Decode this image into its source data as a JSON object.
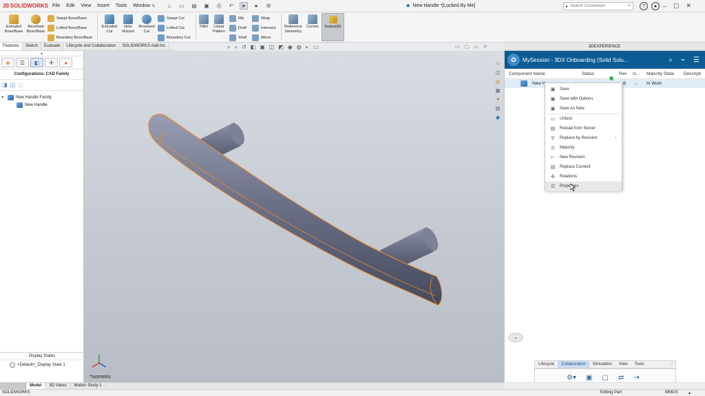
{
  "titlebar": {
    "brand": "SOLIDWORKS",
    "menu": [
      "File",
      "Edit",
      "View",
      "Insert",
      "Tools",
      "Window"
    ],
    "document_title": "New Handle *[Locked By Me]",
    "search_placeholder": "Search Commands"
  },
  "ribbon": {
    "extruded_boss": "Extruded Boss/Base",
    "revolved_boss": "Revolved Boss/Base",
    "swept_boss": "Swept Boss/Base",
    "lofted_boss": "Lofted Boss/Base",
    "boundary_boss": "Boundary Boss/Base",
    "extruded_cut": "Extruded Cut",
    "hole_wizard": "Hole Wizard",
    "revolved_cut": "Revolved Cut",
    "swept_cut": "Swept Cut",
    "lofted_cut": "Lofted Cut",
    "boundary_cut": "Boundary Cut",
    "fillet": "Fillet",
    "linear_pattern": "Linear Pattern",
    "rib": "Rib",
    "draft": "Draft",
    "shell": "Shell",
    "wrap": "Wrap",
    "intersect": "Intersect",
    "mirror": "Mirror",
    "reference_geometry": "Reference Geometry",
    "curves": "Curves",
    "instant3d": "Instant3D"
  },
  "command_tabs": [
    "Features",
    "Sketch",
    "Evaluate",
    "Lifecycle and Collaboration",
    "SOLIDWORKS Add-Ins"
  ],
  "left_panel": {
    "configurations_title": "Configurations: CAD Family",
    "tree": [
      {
        "label": "New Handle Family"
      },
      {
        "label": "New Handle"
      }
    ],
    "display_states_title": "Display States",
    "display_state": "<Default>_Display State 1"
  },
  "viewport": {
    "view_label": "*Isometric"
  },
  "dx_panel": {
    "header_bar": "3DEXPERIENCE",
    "session_title": "MySession - 3DX Onboarding (Solid Solu...",
    "columns": [
      "Component Name",
      "Status",
      "Rev",
      "Is...",
      "Maturity State",
      "Descripti"
    ],
    "row": {
      "name": "New H",
      "rev": "B",
      "maturity": "In Work"
    },
    "context_menu": [
      "Save",
      "Save with Options",
      "Save As New",
      "Unlock",
      "Reload from Server",
      "Replace by Revision",
      "Maturity",
      "New Revision",
      "Replace Content",
      "Relations",
      "Properties"
    ],
    "bottom_tabs": [
      "Lifecycle",
      "Collaboration",
      "Simulation",
      "View",
      "Tools"
    ]
  },
  "bottom_tabs": [
    "Model",
    "3D Views",
    "Motion Study 1"
  ],
  "status_bar": {
    "left": "SOLIDWORKS",
    "mode": "Editing Part",
    "units": "MMGS"
  },
  "colors": {
    "accent": "#0b5c95",
    "brand_red": "#d32f2f",
    "highlight_orange": "#f28c28"
  }
}
